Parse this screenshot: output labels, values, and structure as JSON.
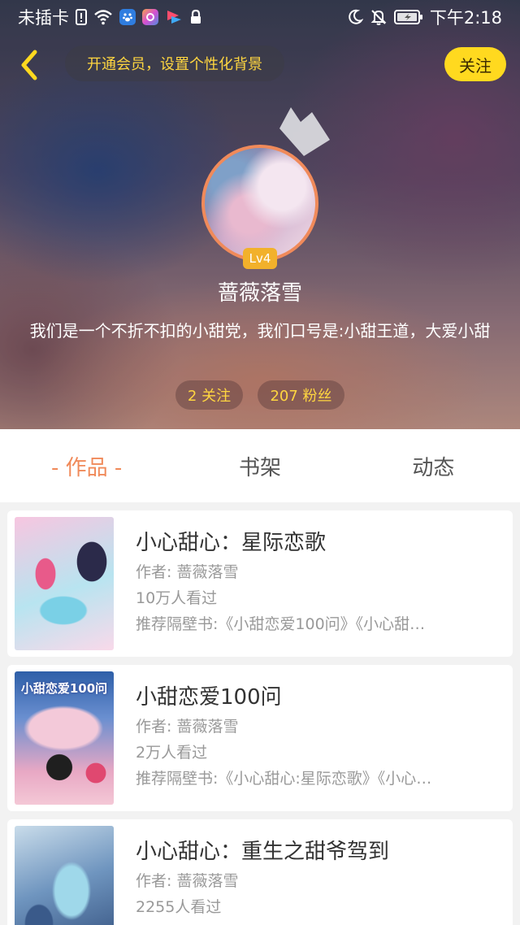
{
  "status_bar": {
    "carrier": "未插卡",
    "time": "下午2:18"
  },
  "header": {
    "vip_text": "开通会员，设置个性化背景",
    "follow_label": "关注"
  },
  "profile": {
    "level": "Lv4",
    "name": "蔷薇落雪",
    "bio": "我们是一个不折不扣的小甜党，我们口号是:小甜王道，大爱小甜",
    "following": "2 关注",
    "followers": "207 粉丝"
  },
  "tabs": [
    {
      "label": "- 作品 -",
      "active": true
    },
    {
      "label": "书架",
      "active": false
    },
    {
      "label": "动态",
      "active": false
    }
  ],
  "books": [
    {
      "title": "小心甜心：星际恋歌",
      "author": "作者: 蔷薇落雪",
      "views": "10万人看过",
      "recommend": "推荐隔壁书:《小甜恋爱100问》《小心甜…"
    },
    {
      "title": "小甜恋爱100问",
      "author": "作者: 蔷薇落雪",
      "views": "2万人看过",
      "recommend": "推荐隔壁书:《小心甜心:星际恋歌》《小心…",
      "cover_text": "小甜恋爱100问"
    },
    {
      "title": "小心甜心：重生之甜爷驾到",
      "author": "作者: 蔷薇落雪",
      "views": "2255人看过",
      "recommend": ""
    }
  ],
  "colors": {
    "accent": "#f08a5a",
    "follow_button": "#ffd91f",
    "vip_text": "#ffd640"
  },
  "icons": [
    "back-chevron-icon",
    "crown-icon",
    "wifi-icon",
    "moon-icon",
    "bell-off-icon",
    "battery-icon",
    "lock-icon"
  ]
}
